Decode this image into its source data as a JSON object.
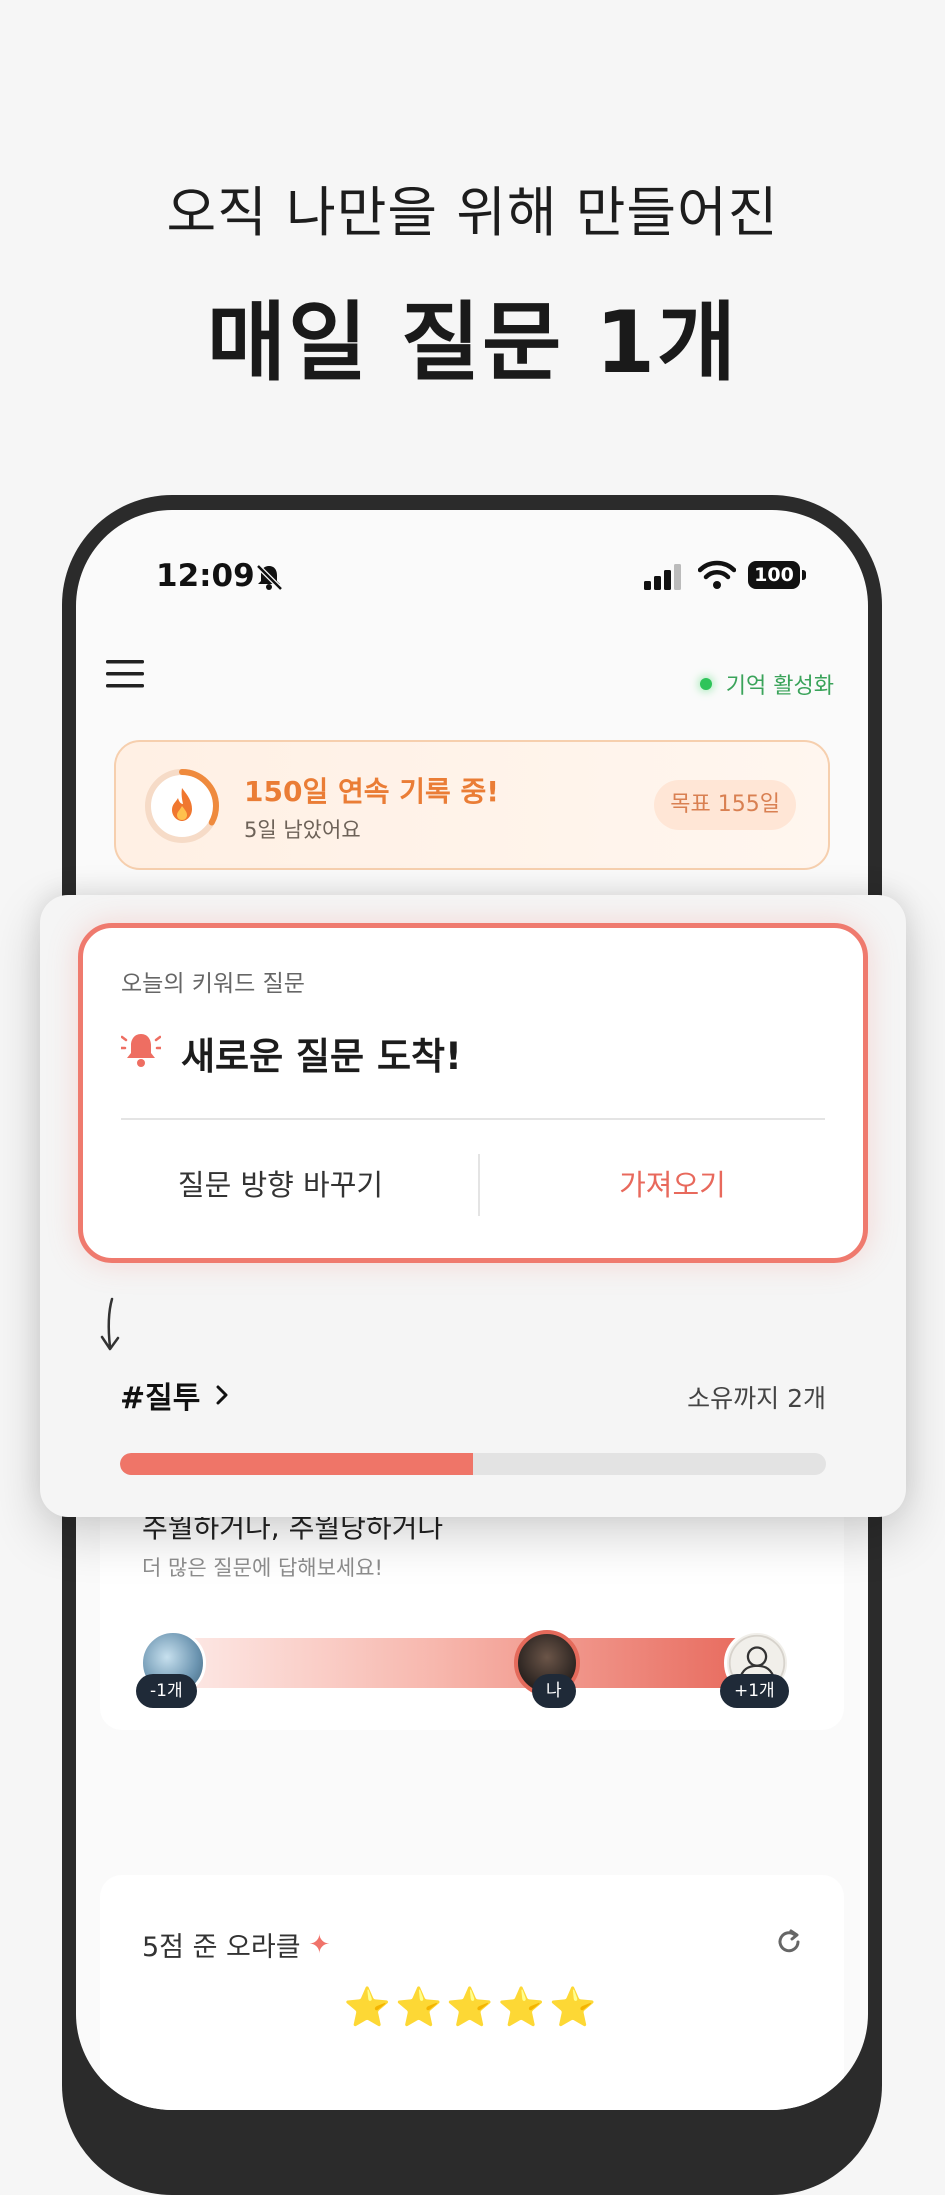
{
  "hero": {
    "line1": "오직 나만을 위해 만들어진",
    "line2": "매일 질문 1개"
  },
  "status_bar": {
    "time": "12:09",
    "battery": "100"
  },
  "header": {
    "memory_status": "기억 활성화"
  },
  "streak": {
    "title": "150일 연속 기록 중!",
    "subtitle": "5일 남았어요",
    "goal": "목표 155일",
    "progress": 0.33
  },
  "popup": {
    "label": "오늘의 키워드 질문",
    "title": "새로운 질문 도착!",
    "change_button": "질문 방향 바꾸기",
    "fetch_button": "가져오기",
    "keyword": "#질투",
    "keyword_count": "소유까지 2개",
    "keyword_progress": 0.5
  },
  "ranking": {
    "title": "추월하거나, 추월당하거나",
    "subtitle": "더 많은 질문에 답해보세요!",
    "left_pill": "-1개",
    "mid_pill": "나",
    "right_pill": "+1개"
  },
  "oracle": {
    "title": "5점 준 오라클",
    "stars": "⭐⭐⭐⭐⭐"
  },
  "colors": {
    "accent": "#ef7a6e",
    "streak": "#ea7d36",
    "memory": "#3aa35a"
  }
}
